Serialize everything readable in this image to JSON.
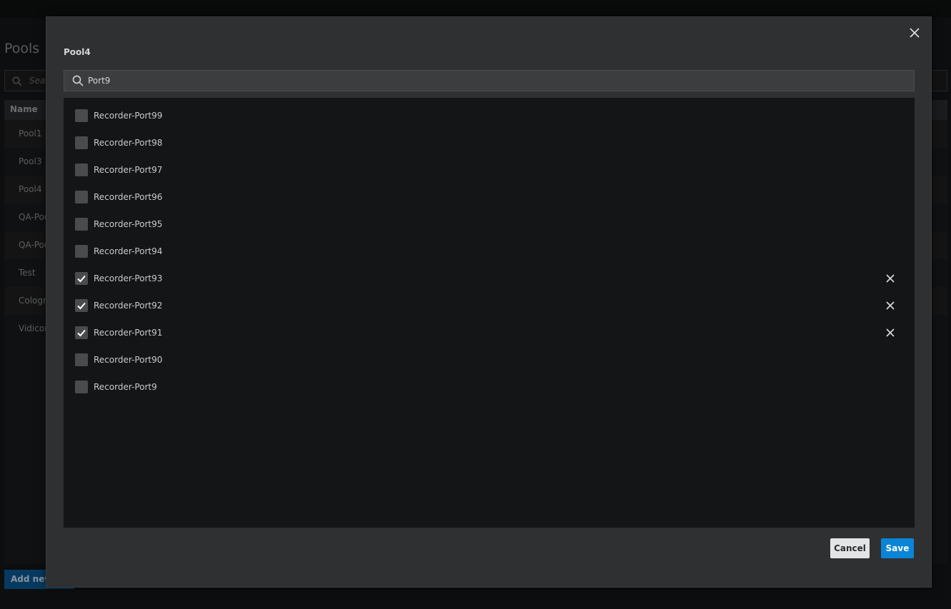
{
  "background": {
    "title": "Pools",
    "search_placeholder": "Search",
    "table_header": "Name",
    "rows": [
      "Pool1",
      "Pool3",
      "Pool4",
      "QA-Pool",
      "QA-Pool",
      "Test",
      "Cologne",
      "Vidicore"
    ],
    "add_button": "Add new"
  },
  "modal": {
    "title": "Pool4",
    "search_value": "Port9",
    "items": [
      {
        "label": "Recorder-Port99",
        "checked": false
      },
      {
        "label": "Recorder-Port98",
        "checked": false
      },
      {
        "label": "Recorder-Port97",
        "checked": false
      },
      {
        "label": "Recorder-Port96",
        "checked": false
      },
      {
        "label": "Recorder-Port95",
        "checked": false
      },
      {
        "label": "Recorder-Port94",
        "checked": false
      },
      {
        "label": "Recorder-Port93",
        "checked": true
      },
      {
        "label": "Recorder-Port92",
        "checked": true
      },
      {
        "label": "Recorder-Port91",
        "checked": true
      },
      {
        "label": "Recorder-Port90",
        "checked": false
      },
      {
        "label": "Recorder-Port9",
        "checked": false
      }
    ],
    "cancel_label": "Cancel",
    "save_label": "Save"
  },
  "colors": {
    "accent": "#0a84d6",
    "modal_bg": "#2f3032",
    "list_bg": "#141516"
  },
  "icons": {
    "close": "close-icon",
    "search": "search-icon",
    "check": "checkmark-icon",
    "remove": "remove-icon"
  }
}
